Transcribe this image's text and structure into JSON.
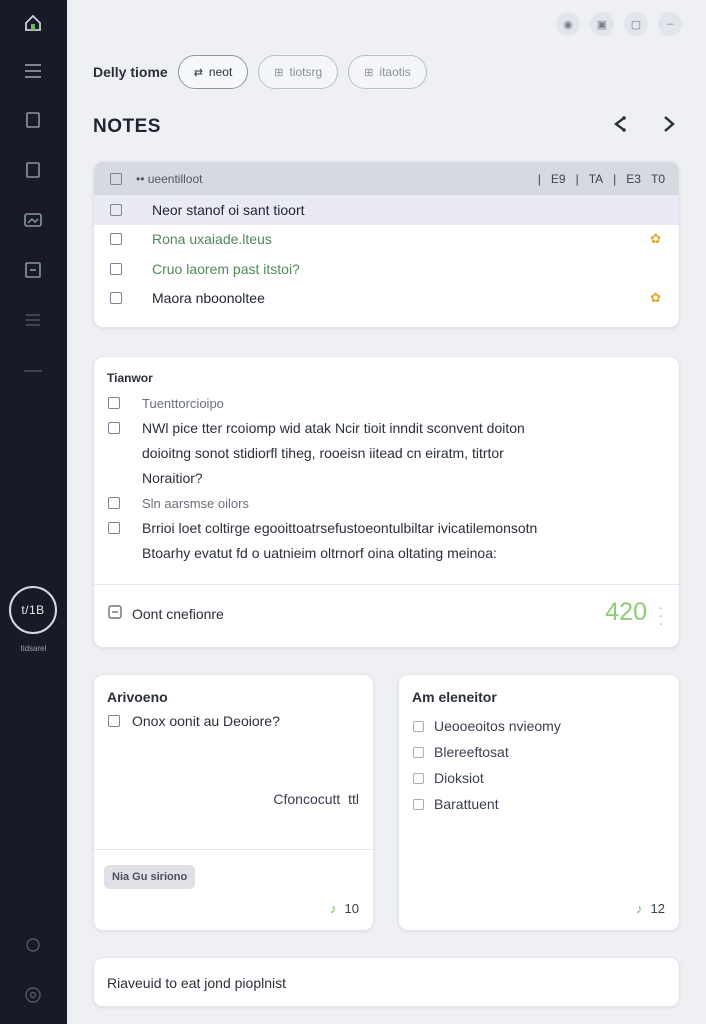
{
  "sidebar": {
    "avatar_initials": "t/1B",
    "avatar_label": "tidsarel"
  },
  "header": {
    "title": "Delly tiome",
    "pills": [
      {
        "label": "neot",
        "glyph": "⇄"
      },
      {
        "label": "tiotsrg",
        "glyph": "⊞"
      },
      {
        "label": "itaotis",
        "glyph": "⊞"
      }
    ]
  },
  "notes": {
    "section_title": "NOTES",
    "header_label": "ueentilloot",
    "columns": [
      "E9",
      "TA",
      "E3",
      "T0"
    ],
    "rows": [
      {
        "text": "Neor stanof oi sant tioort"
      },
      {
        "text": "Rona uxaiade.lteus"
      },
      {
        "text": "Cruo laorem past itstoi?"
      },
      {
        "text": "Maora nboonoltee"
      }
    ]
  },
  "tasks": {
    "title": "Tianwor",
    "items": [
      {
        "text": "Tuenttorcioipo"
      },
      {
        "text": "NWl pice tter rcoiomp wid atak Ncir tioit inndit sconvent doiton"
      },
      {
        "text": "doioitng sonot stidiorfl tiheg, rooeisn iitead cn eiratm, titrtor"
      },
      {
        "text": "Noraitior?"
      },
      {
        "text": "Sln aarsmse oilors"
      },
      {
        "text": "Brrioi loet coltirge egooittoatrsefustoeontulbiltar ivicatilemonsotn"
      },
      {
        "text": "Btoarhy evatut fd o uatnieim oltrnorf oina oltating meinoa:"
      }
    ],
    "footer_label": "Oont cnefionre",
    "count": "420"
  },
  "arivoeno": {
    "title": "Arivoeno",
    "item": "Onox oonit au Deoiore?",
    "link": "Cfoncocutt",
    "link_suffix": "ttl",
    "chip": "Nia Gu siriono",
    "count": "10"
  },
  "amenevitor": {
    "title": "Am eleneitor",
    "items": [
      "Ueooeoitos nvieomy",
      "Blereeftosat",
      "Dioksiot",
      "Barattuent"
    ],
    "count": "12"
  },
  "footer": {
    "text": "Riaveuid to eat jond pioplnist"
  },
  "colors": {
    "sidebar_bg": "#161b26",
    "accent_green": "#8ccd76",
    "star": "#e7a628"
  }
}
